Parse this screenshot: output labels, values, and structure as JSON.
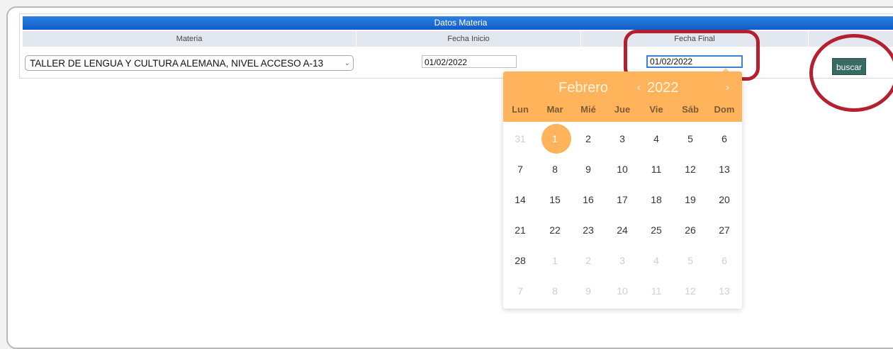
{
  "table": {
    "title": "Datos Materia",
    "headers": [
      "Materia",
      "Fecha Inicio",
      "Fecha Final",
      ""
    ],
    "materia_selected": "TALLER DE LENGUA Y CULTURA ALEMANA, NIVEL ACCESO A-13",
    "fecha_inicio": "01/02/2022",
    "fecha_final": "01/02/2022",
    "buscar_label": "buscar"
  },
  "calendar": {
    "month": "Febrero",
    "year": "2022",
    "prev_arrow": "‹",
    "next_arrow": "›",
    "weekdays": [
      "Lun",
      "Mar",
      "Mié",
      "Jue",
      "Vie",
      "Sáb",
      "Dom"
    ],
    "weeks": [
      [
        "31",
        "1",
        "2",
        "3",
        "4",
        "5",
        "6"
      ],
      [
        "7",
        "8",
        "9",
        "10",
        "11",
        "12",
        "13"
      ],
      [
        "14",
        "15",
        "16",
        "17",
        "18",
        "19",
        "20"
      ],
      [
        "21",
        "22",
        "23",
        "24",
        "25",
        "26",
        "27"
      ],
      [
        "28",
        "1",
        "2",
        "3",
        "4",
        "5",
        "6"
      ],
      [
        "7",
        "8",
        "9",
        "10",
        "11",
        "12",
        "13"
      ]
    ],
    "selected_day": "1"
  },
  "colors": {
    "header_blue": "#0e5cc7",
    "calendar_orange": "#ffb45c",
    "annotation_red": "#b51f2f",
    "button_green": "#3a6b63"
  }
}
